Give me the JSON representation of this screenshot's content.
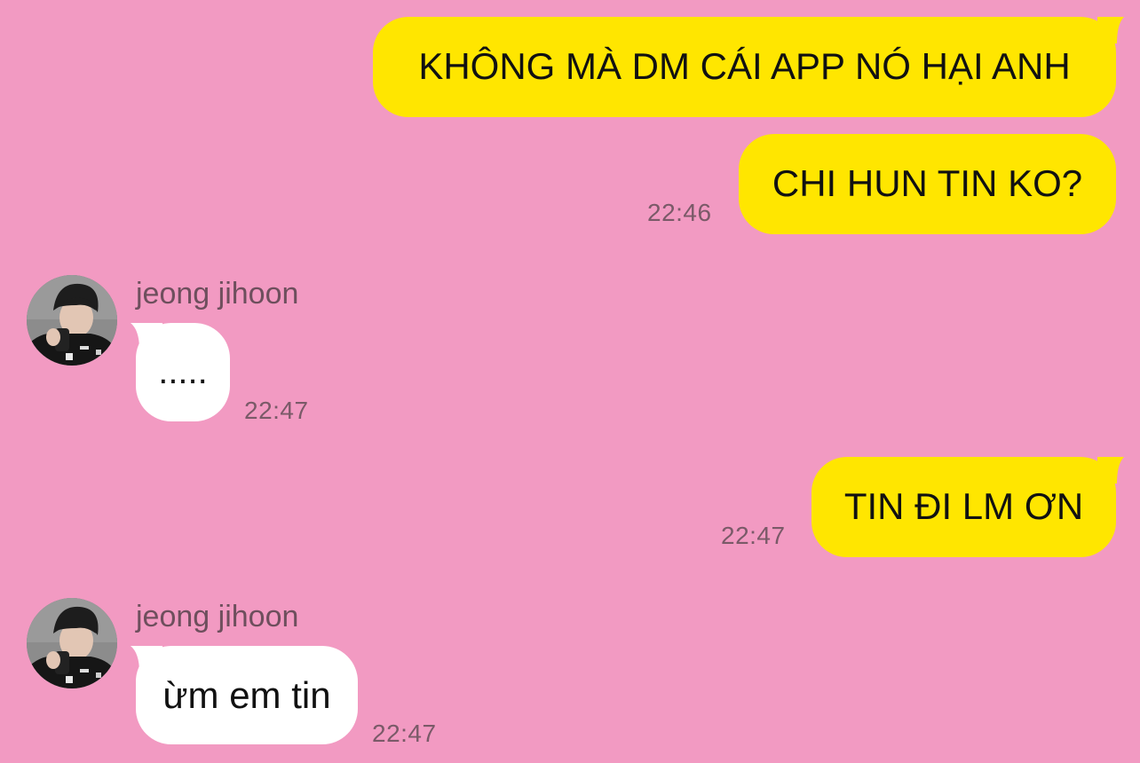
{
  "conversation": {
    "messages": [
      {
        "direction": "outgoing",
        "text": "KHÔNG MÀ DM CÁI APP NÓ HẠI ANH"
      },
      {
        "direction": "outgoing",
        "text": "CHI HUN TIN KO?",
        "time": "22:46"
      },
      {
        "direction": "incoming",
        "sender": "jeong jihoon",
        "text": ".....",
        "time": "22:47"
      },
      {
        "direction": "outgoing",
        "text": "TIN ĐI LM ƠN",
        "time": "22:47"
      },
      {
        "direction": "incoming",
        "sender": "jeong jihoon",
        "text": "ừm em tin",
        "time": "22:47"
      }
    ]
  },
  "colors": {
    "background": "#F29AC2",
    "outgoing_bubble": "#FFE600",
    "incoming_bubble": "#FFFFFF",
    "timestamp": "#7A5A68",
    "sender_name": "#6E4F5D"
  },
  "icons": {
    "avatar": "contact-avatar-photo"
  }
}
